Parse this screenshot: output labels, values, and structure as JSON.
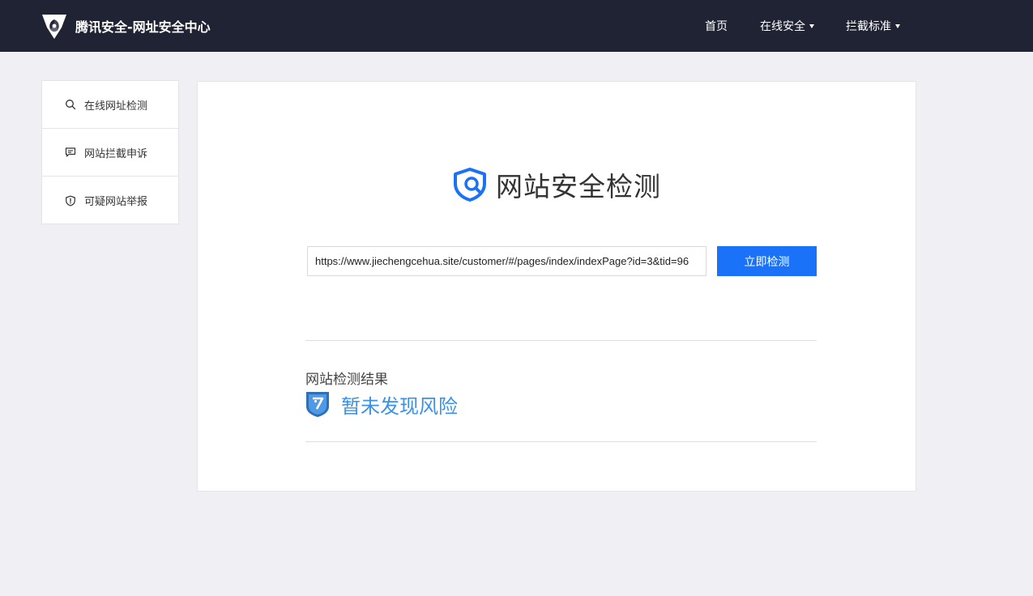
{
  "header": {
    "logo_text": "腾讯安全-网址安全中心",
    "nav": {
      "home": "首页",
      "online_security": "在线安全",
      "block_standard": "拦截标准"
    }
  },
  "sidebar": {
    "items": [
      {
        "label": "在线网址检测",
        "icon": "search-icon"
      },
      {
        "label": "网站拦截申诉",
        "icon": "message-icon"
      },
      {
        "label": "可疑网站举报",
        "icon": "shield-alert-icon"
      }
    ]
  },
  "main": {
    "title": "网站安全检测",
    "url_value": "https://www.jiechengcehua.site/customer/#/pages/index/indexPage?id=3&tid=96",
    "check_button": "立即检测",
    "result_label": "网站检测结果",
    "result_text": "暂未发现风险"
  },
  "colors": {
    "header_bg": "#202333",
    "accent": "#1a72f9",
    "result_text": "#3a92e6",
    "page_bg": "#efeff4"
  }
}
